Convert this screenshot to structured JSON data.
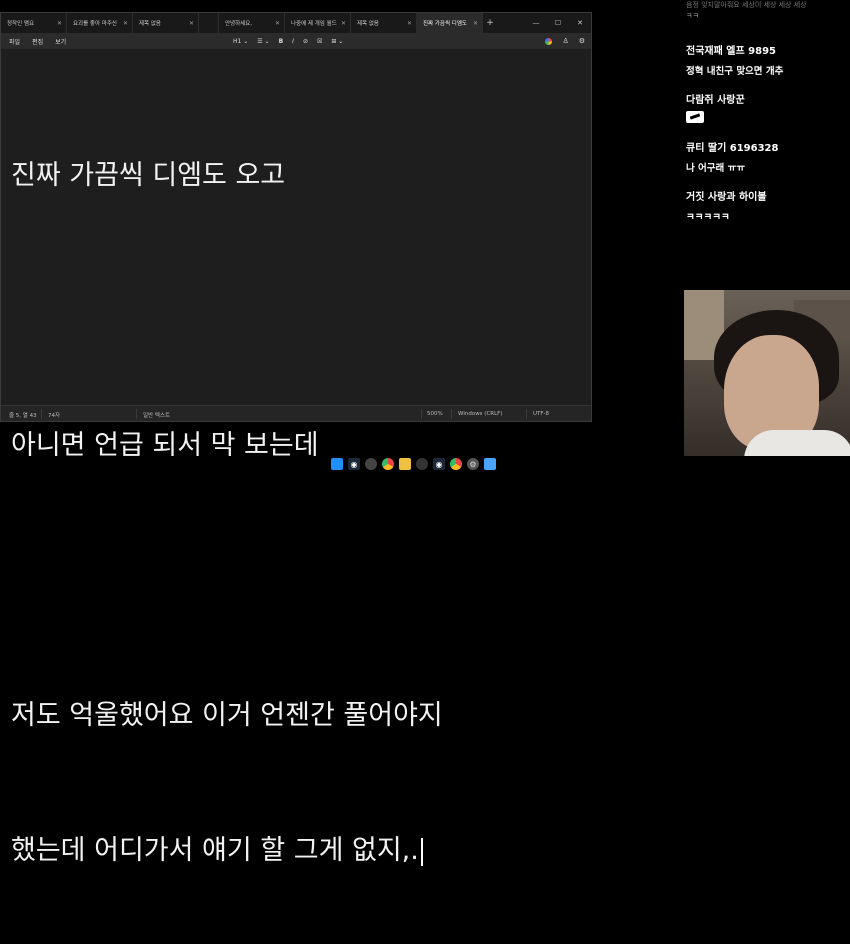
{
  "notepad": {
    "tabs": [
      {
        "label": "정작인 맴요"
      },
      {
        "label": "요괴를 좋아 마주신"
      },
      {
        "label": "제목 없음"
      },
      {
        "label": ""
      },
      {
        "label": "안녕하세요,"
      },
      {
        "label": "나중에 제 개임 월드"
      },
      {
        "label": "제목 없음"
      },
      {
        "label": "진짜 가끔씩 디엠도"
      }
    ],
    "active_tab_index": 7,
    "new_tab": "+",
    "window_controls": {
      "minimize": "—",
      "maximize": "☐",
      "close": "✕"
    },
    "menu": {
      "file": "파일",
      "edit": "편집",
      "view": "보기"
    },
    "format": {
      "heading": "H1 ⌄",
      "list": "☰ ⌄",
      "bold": "B",
      "italic": "I",
      "link": "⊘",
      "clear": "☒",
      "table": "⊞ ⌄"
    },
    "editor_lines": [
      "진짜 가끔씩 디엠도 오고",
      "",
      "아니면 언급 되서 막 보는데",
      "",
      "저도 억울했어요 이거 언젠간 풀어야지",
      "했는데 어디가서 얘기 할 그게 없지,."
    ],
    "status": {
      "position": "줄 5, 열 43",
      "chars": "74자",
      "format": "일반 텍스트",
      "zoom": "500%",
      "line_ending": "Windows (CRLF)",
      "encoding": "UTF-8"
    }
  },
  "chat": {
    "top_fade": "음정 잊지말아줘요 세상이 세상 세상 세상",
    "top_line2": "ㅋㅋ",
    "messages": [
      {
        "name": "전국재패 엘프 9895",
        "body": "정혁 내친구 맞으면 개추"
      },
      {
        "name": "다람쥐 사랑꾼",
        "body": "",
        "emote": true
      },
      {
        "name": "큐티 딸기 6196328",
        "body": "나 어구래 ㅠㅠ"
      },
      {
        "name": "거짓 사랑과 하이볼",
        "body": "ㅋㅋㅋㅋㅋ"
      }
    ]
  },
  "taskbar": {
    "icons": [
      "windows-icon",
      "steam-icon",
      "chat-icon",
      "chrome-icon",
      "file-explorer-icon",
      "obs-icon",
      "steam-icon",
      "chrome-icon",
      "settings-icon",
      "notepad-icon"
    ]
  }
}
